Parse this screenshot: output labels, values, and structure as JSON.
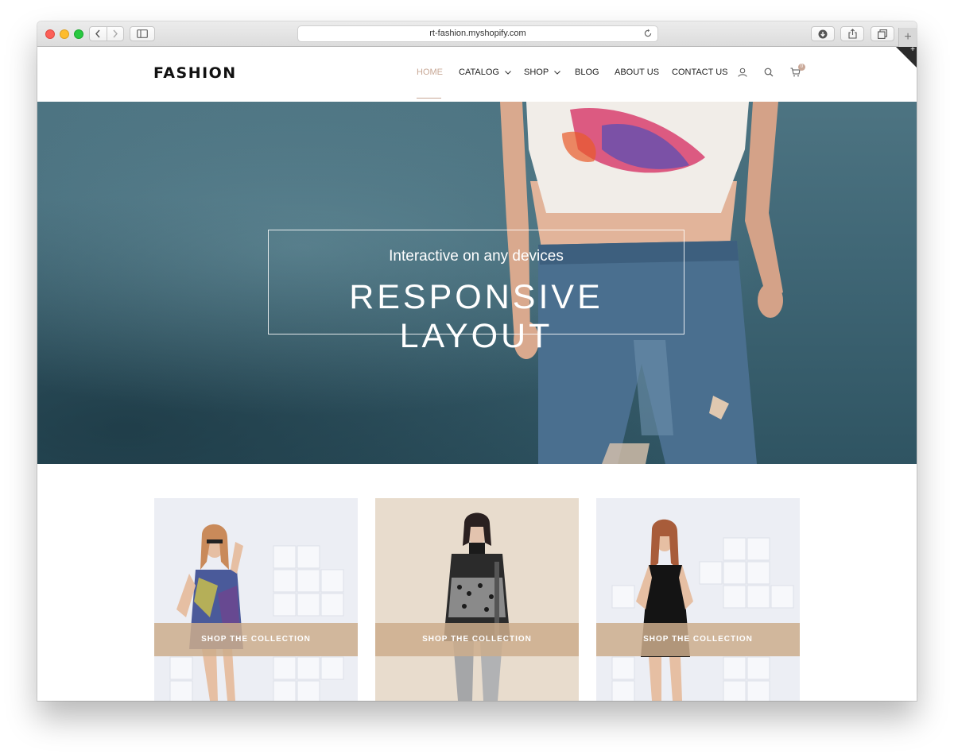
{
  "browser": {
    "url": "rt-fashion.myshopify.com"
  },
  "site": {
    "logo": "FASHION",
    "nav": {
      "home": "HOME",
      "catalog": "CATALOG",
      "shop": "SHOP",
      "blog": "BLOG",
      "about": "ABOUT US",
      "contact": "CONTACT US"
    },
    "cart_count": "0",
    "accent_color": "#c8a896"
  },
  "hero": {
    "subtitle": "Interactive on any devices",
    "title": "RESPONSIVE LAYOUT"
  },
  "collections": [
    {
      "label": "SHOP THE COLLECTION"
    },
    {
      "label": "SHOP THE COLLECTION"
    },
    {
      "label": "SHOP THE COLLECTION"
    }
  ]
}
